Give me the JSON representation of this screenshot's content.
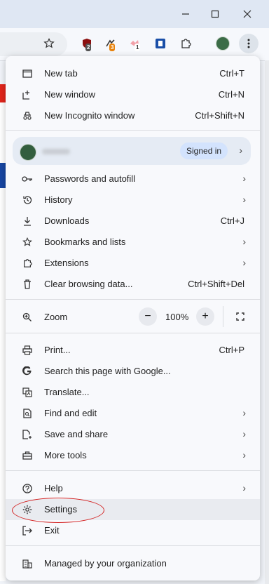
{
  "window": {
    "minimize_icon": "minimize-icon",
    "maximize_icon": "maximize-icon",
    "close_icon": "close-icon"
  },
  "toolbar": {
    "star_icon": "star-icon",
    "extensions": [
      {
        "name": "ublock-icon",
        "badge": "2"
      },
      {
        "name": "extension-icon",
        "badge": "3"
      },
      {
        "name": "extension-icon",
        "badge": "1"
      }
    ],
    "menu_icon": "kebab-menu-icon"
  },
  "menu": {
    "new_tab": {
      "label": "New tab",
      "shortcut": "Ctrl+T"
    },
    "new_window": {
      "label": "New window",
      "shortcut": "Ctrl+N"
    },
    "incognito": {
      "label": "New Incognito window",
      "shortcut": "Ctrl+Shift+N"
    },
    "profile": {
      "status": "Signed in"
    },
    "passwords": {
      "label": "Passwords and autofill"
    },
    "history": {
      "label": "History"
    },
    "downloads": {
      "label": "Downloads",
      "shortcut": "Ctrl+J"
    },
    "bookmarks": {
      "label": "Bookmarks and lists"
    },
    "extensions": {
      "label": "Extensions"
    },
    "clear": {
      "label": "Clear browsing data...",
      "shortcut": "Ctrl+Shift+Del"
    },
    "zoom": {
      "label": "Zoom",
      "value": "100%",
      "minus": "−",
      "plus": "+"
    },
    "print": {
      "label": "Print...",
      "shortcut": "Ctrl+P"
    },
    "search_page": {
      "label": "Search this page with Google..."
    },
    "translate": {
      "label": "Translate..."
    },
    "find_edit": {
      "label": "Find and edit"
    },
    "save_share": {
      "label": "Save and share"
    },
    "more_tools": {
      "label": "More tools"
    },
    "help": {
      "label": "Help"
    },
    "settings": {
      "label": "Settings"
    },
    "exit": {
      "label": "Exit"
    },
    "managed": {
      "label": "Managed by your organization"
    }
  },
  "colors": {
    "highlight_circle": "#d32020",
    "accent": "#d3e3fd"
  }
}
